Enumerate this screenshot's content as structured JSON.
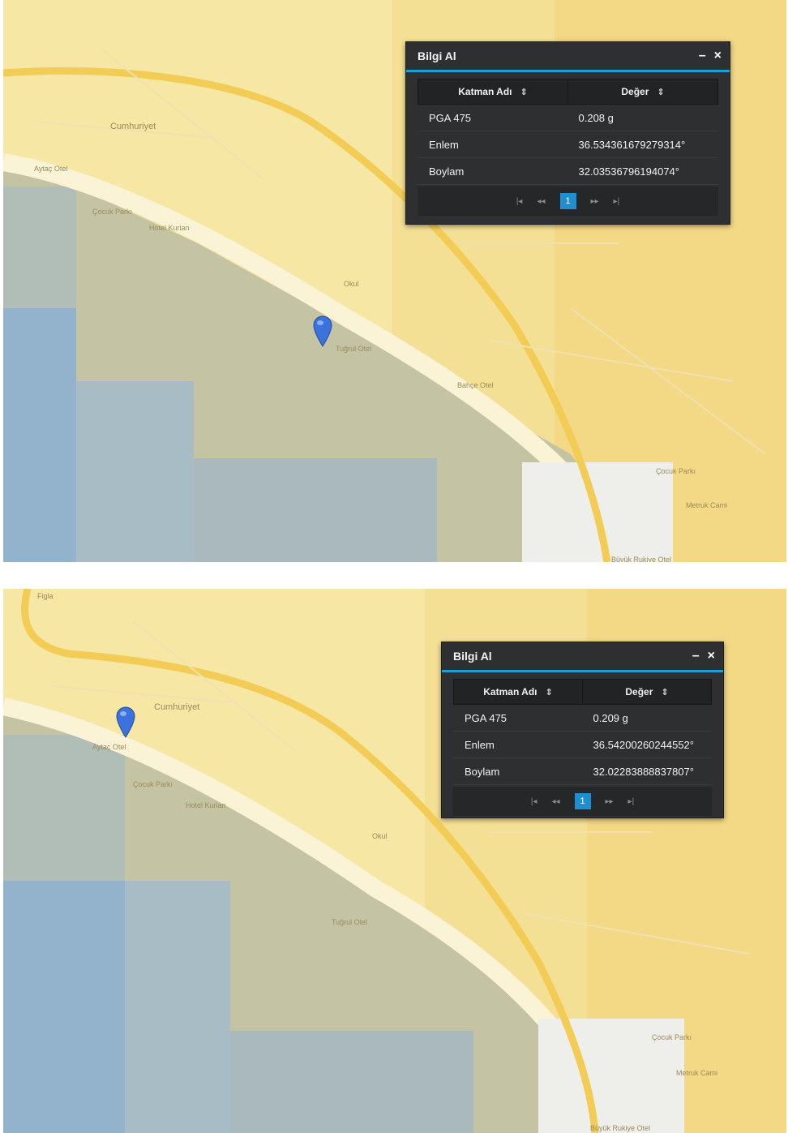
{
  "colors": {
    "sea": "#9fb7c6",
    "land": "#f6e7a4",
    "road": "#f2cc55",
    "panel": "#2e2f31",
    "accent": "#1aa0d9",
    "marker": "#3c72dd"
  },
  "screens": [
    {
      "panel": {
        "title": "Bilgi Al",
        "minimize_icon": "–",
        "close_icon": "×",
        "columns": [
          {
            "label": "Katman Adı",
            "sort_icon": "⇕"
          },
          {
            "label": "Değer",
            "sort_icon": "⇕"
          }
        ],
        "rows": [
          {
            "name": "PGA 475",
            "value": "0.208 g"
          },
          {
            "name": "Enlem",
            "value": "36.534361679279314°"
          },
          {
            "name": "Boylam",
            "value": "32.03536796194074°"
          }
        ],
        "pager": {
          "first": "|◂",
          "prev": "◂◂",
          "page": "1",
          "next": "▸▸",
          "last": "▸|"
        }
      },
      "labels": [
        "Cumhuriyet",
        "Aytaç Otel",
        "Çocuk Parkı",
        "Hotel Kurian",
        "Okul",
        "Tuğrul Otel",
        "Bahçe Otel",
        "Çocuk Parkı",
        "Metruk Cami",
        "Büyük Rukiye Otel"
      ]
    },
    {
      "panel": {
        "title": "Bilgi Al",
        "minimize_icon": "–",
        "close_icon": "×",
        "columns": [
          {
            "label": "Katman Adı",
            "sort_icon": "⇕"
          },
          {
            "label": "Değer",
            "sort_icon": "⇕"
          }
        ],
        "rows": [
          {
            "name": "PGA 475",
            "value": "0.209 g"
          },
          {
            "name": "Enlem",
            "value": "36.54200260244552°"
          },
          {
            "name": "Boylam",
            "value": "32.02283888837807°"
          }
        ],
        "pager": {
          "first": "|◂",
          "prev": "◂◂",
          "page": "1",
          "next": "▸▸",
          "last": "▸|"
        }
      },
      "labels": [
        "Figla",
        "Cumhuriyet",
        "Aytaç Otel",
        "Çocuk Parkı",
        "Hotel Kurian",
        "Okul",
        "Tuğrul Otel",
        "Çocuk Parkı",
        "Metruk Cami",
        "Büyük Rukiye Otel"
      ]
    }
  ]
}
